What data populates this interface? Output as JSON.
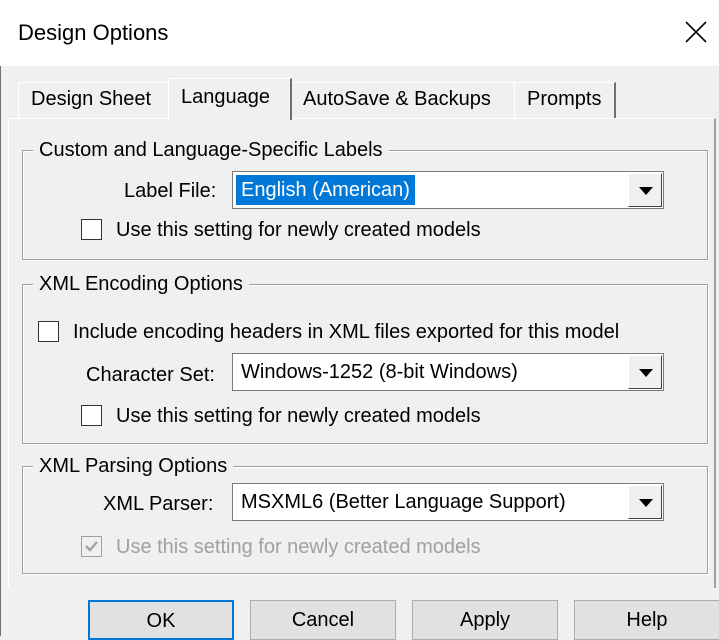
{
  "window": {
    "title": "Design Options"
  },
  "tabs": [
    {
      "label": "Design Sheet",
      "active": false
    },
    {
      "label": "Language",
      "active": true
    },
    {
      "label": "AutoSave & Backups",
      "active": false
    },
    {
      "label": "Prompts",
      "active": false
    }
  ],
  "groups": {
    "labels": {
      "title": "Custom and Language-Specific Labels",
      "label_file_label": "Label File:",
      "label_file_value": "English (American)",
      "use_setting_label": "Use this setting for newly created models",
      "use_setting_checked": false
    },
    "xml_encoding": {
      "title": "XML Encoding Options",
      "include_headers_label": "Include encoding headers in XML files exported for this model",
      "include_headers_checked": false,
      "character_set_label": "Character Set:",
      "character_set_value": "Windows-1252 (8-bit Windows)",
      "use_setting_label": "Use this setting for newly created models",
      "use_setting_checked": false
    },
    "xml_parsing": {
      "title": "XML Parsing Options",
      "parser_label": "XML Parser:",
      "parser_value": "MSXML6 (Better Language Support)",
      "use_setting_label": "Use this setting for newly created models",
      "use_setting_checked": true,
      "use_setting_disabled": true
    }
  },
  "buttons": {
    "ok": "OK",
    "cancel": "Cancel",
    "apply": "Apply",
    "help": "Help"
  },
  "icons": {
    "close": "close-icon",
    "dropdown": "chevron-down-icon",
    "check": "check-icon"
  },
  "colors": {
    "selection": "#0078d7",
    "disabled_text": "#a0a0a0",
    "background": "#f0f0f0"
  }
}
